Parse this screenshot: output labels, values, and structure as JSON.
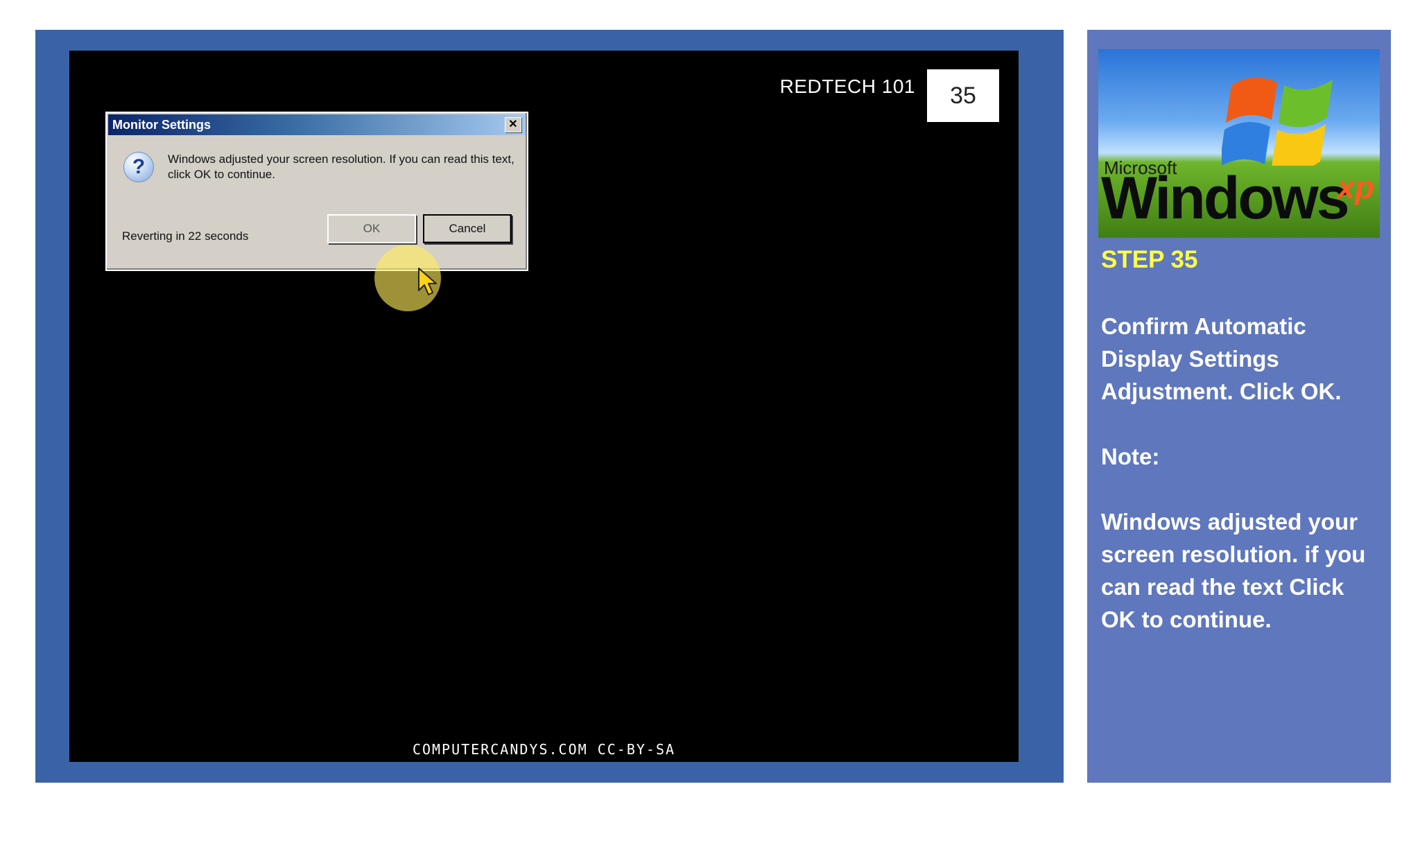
{
  "slide": {
    "course_label": "REDTECH 101",
    "step_number": "35",
    "credit": "COMPUTERCANDYS.COM CC-BY-SA"
  },
  "dialog": {
    "title": "Monitor Settings",
    "close_glyph": "✕",
    "message": "Windows adjusted your screen resolution. If you can read this text, click OK to continue.",
    "countdown": "Reverting in 22 seconds",
    "ok_label": "OK",
    "cancel_label": "Cancel",
    "icon": "question-icon"
  },
  "logo": {
    "microsoft": "Microsoft",
    "windows": "Windows",
    "xp": "xp"
  },
  "panel": {
    "step_title": "STEP 35",
    "instruction": "Confirm Automatic Display Settings Adjustment. Click OK.",
    "note_label": "Note:",
    "note_text": "Windows adjusted your screen resolution. if you can read the text Click OK to continue."
  },
  "colors": {
    "frame_blue": "#3a63a7",
    "panel_blue": "#5f77bd",
    "step_yellow": "#ffff44",
    "highlight_yellow": "#ffeb5a"
  }
}
